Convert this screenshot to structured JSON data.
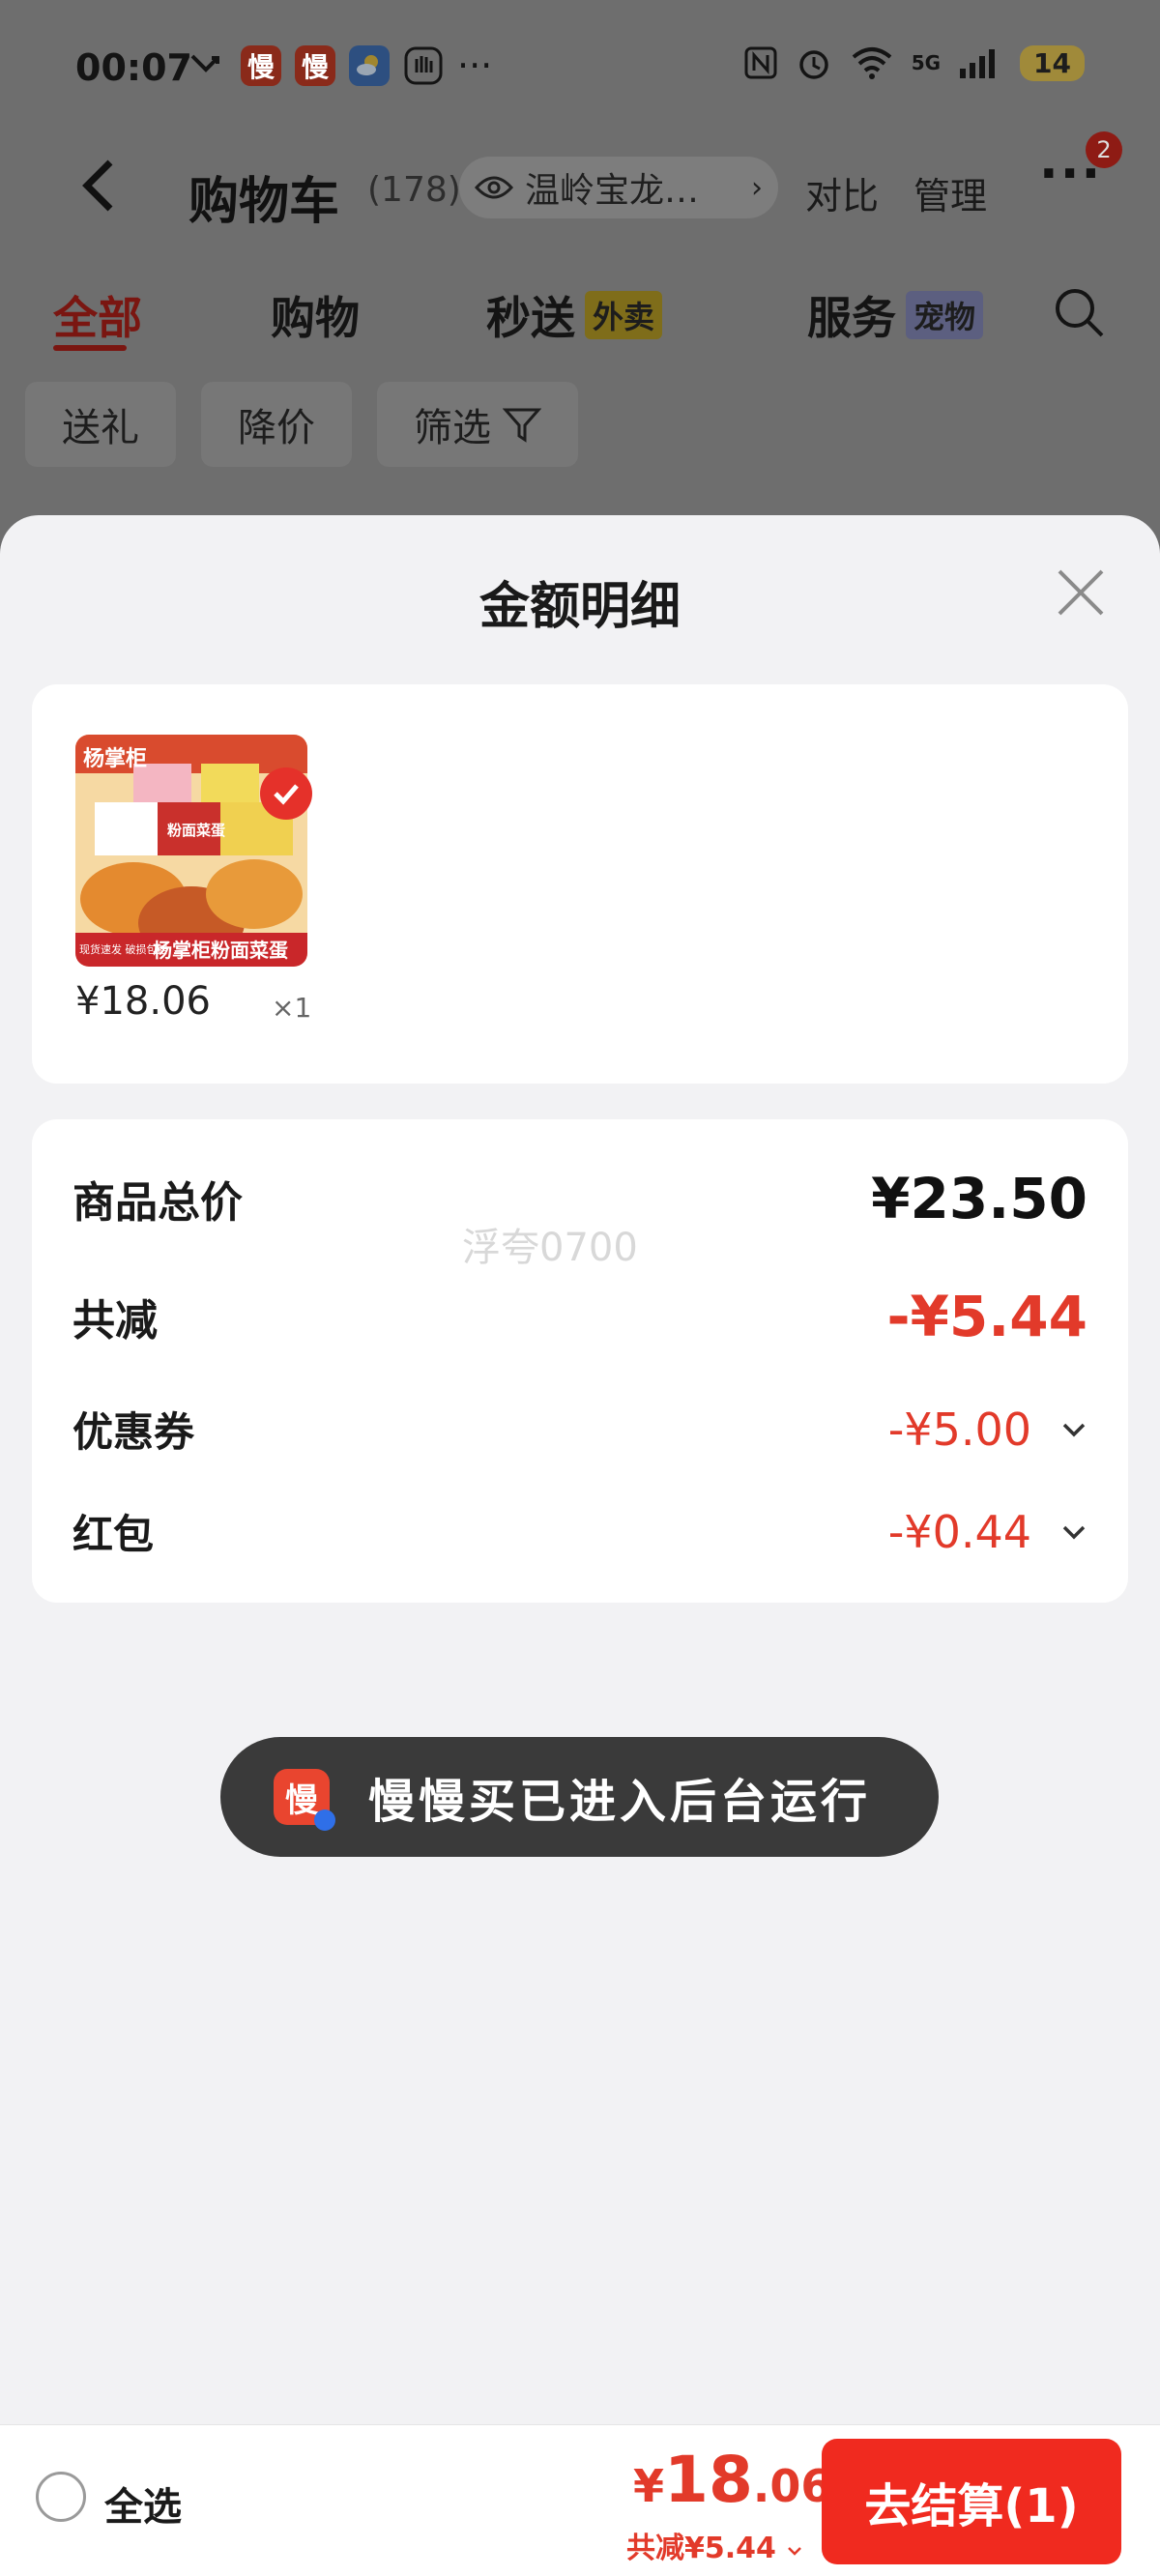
{
  "status_bar": {
    "time": "00:07",
    "app_badge_1": "慢",
    "app_badge_2": "慢",
    "more": "···",
    "network": "5G",
    "battery": "14"
  },
  "header": {
    "back_icon": "chevron-left-icon",
    "title": "购物车",
    "count": "(178)",
    "address": "温岭宝龙…",
    "compare": "对比",
    "manage": "管理",
    "more": "···",
    "notification_count": "2"
  },
  "tabs": [
    {
      "label": "全部",
      "active": true
    },
    {
      "label": "购物",
      "active": false
    },
    {
      "label": "秒送",
      "tag": "外卖",
      "active": false
    },
    {
      "label": "服务",
      "tag": "宠物",
      "active": false
    }
  ],
  "chips": [
    {
      "label": "送礼"
    },
    {
      "label": "降价"
    },
    {
      "label": "筛选"
    }
  ],
  "sheet": {
    "title": "金额明细",
    "item": {
      "image_alt": "杨掌柜粉面菜蛋",
      "image_caption": "杨掌柜粉面菜蛋",
      "image_badge": "现货速发 破损包赔",
      "image_brand": "杨掌柜",
      "image_label": "粉面菜蛋",
      "price": "¥18.06",
      "qty": "×1"
    },
    "summary": {
      "total_label": "商品总价",
      "total_value": "¥23.50",
      "discount_label": "共减",
      "discount_value": "-¥5.44",
      "coupon_label": "优惠券",
      "coupon_value": "-¥5.00",
      "redpacket_label": "红包",
      "redpacket_value": "-¥0.44",
      "watermark": "浮夸0700"
    }
  },
  "toast": {
    "icon_text": "慢",
    "message": "慢慢买已进入后台运行"
  },
  "checkout": {
    "select_all": "全选",
    "currency": "¥",
    "total_int": "18",
    "total_dec": ".06",
    "saved": "共减¥5.44",
    "pay_label": "去结算(1)"
  },
  "colors": {
    "accent": "#e23a2a",
    "pay_button": "#f02a1f",
    "sheet_bg": "#f2f2f4",
    "overlay": "#6e6e6e"
  }
}
